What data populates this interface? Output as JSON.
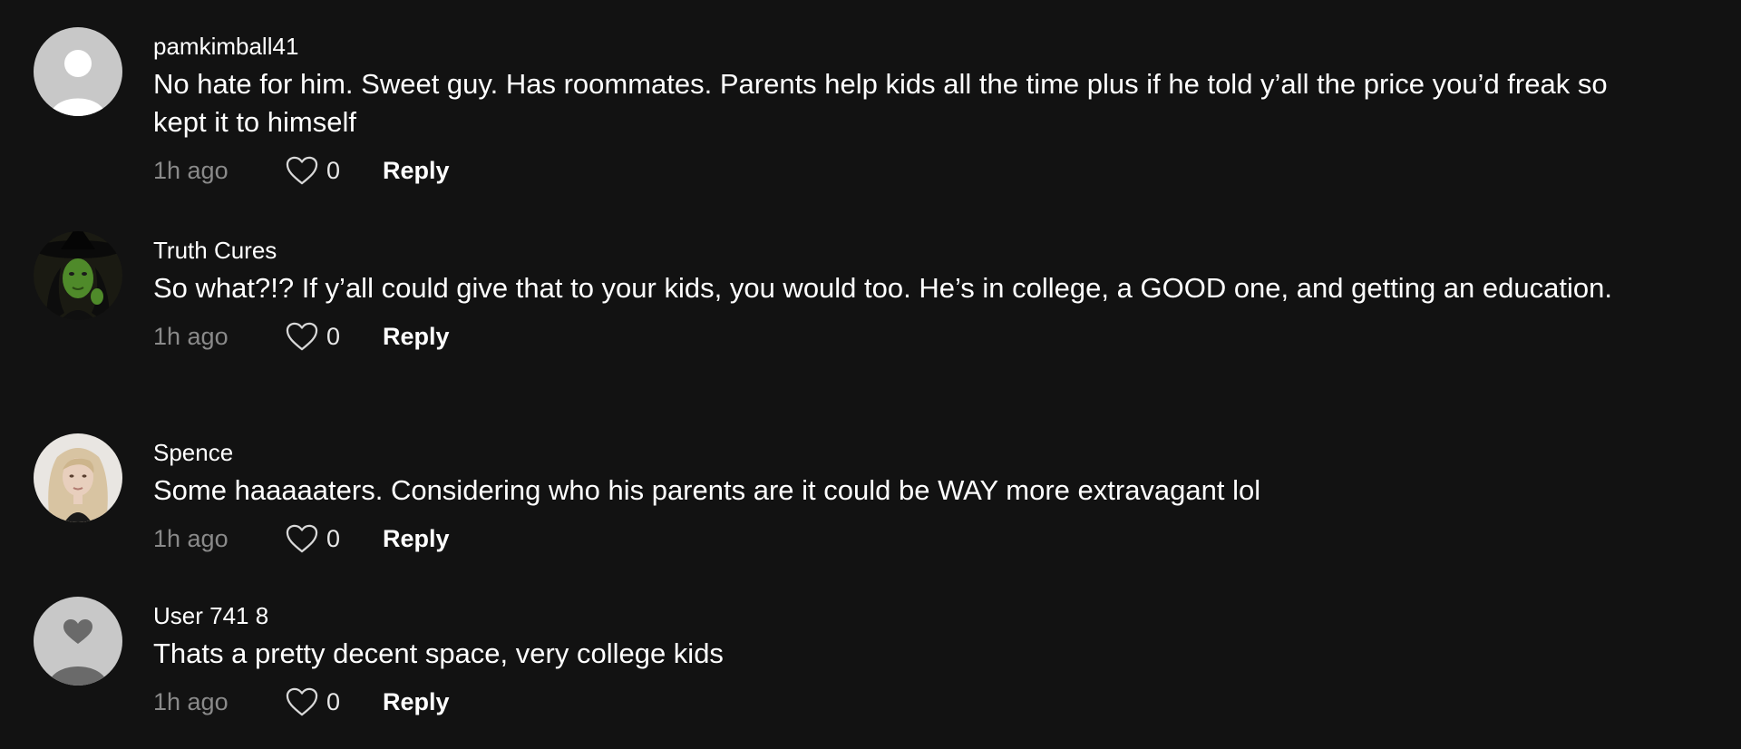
{
  "comments": [
    {
      "username": "pamkimball41",
      "text": "No hate for him. Sweet guy. Has roommates. Parents help kids all the time plus if he told y’all the price you’d freak so kept it to himself",
      "time": "1h ago",
      "likes": "0",
      "reply_label": "Reply",
      "avatar": "default-user-avatar"
    },
    {
      "username": "Truth Cures",
      "text": "So what?!? If y’all could give that to your kids, you would too. He’s in college, a GOOD one, and getting an education.",
      "time": "1h ago",
      "likes": "0",
      "reply_label": "Reply",
      "avatar": "witch-avatar"
    },
    {
      "username": "Spence",
      "text": "Some haaaaaters. Considering who his parents are it could be WAY more extravagant lol",
      "time": "1h ago",
      "likes": "0",
      "reply_label": "Reply",
      "avatar": "blonde-woman-avatar"
    },
    {
      "username": "User 741 8",
      "text": "Thats a pretty decent space, very college kids",
      "time": "1h ago",
      "likes": "0",
      "reply_label": "Reply",
      "avatar": "heart-user-avatar"
    }
  ],
  "colors": {
    "background": "#121212",
    "text": "#ffffff",
    "secondary_text": "#8a8a8a",
    "default_avatar": "#c8c8c8"
  }
}
